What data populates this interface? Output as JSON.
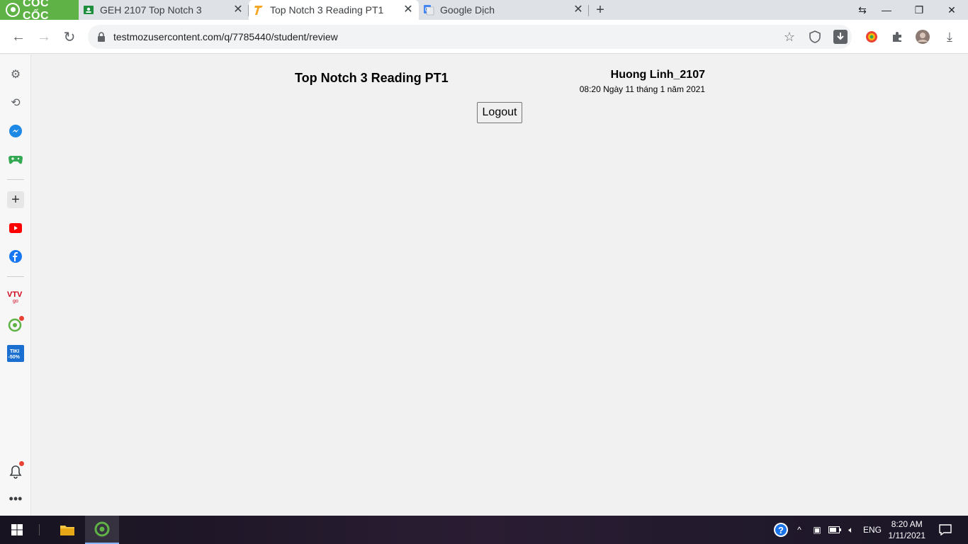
{
  "browser": {
    "brand": "CỐC CỐC",
    "tabs": [
      {
        "title": "GEH 2107 Top Notch 3",
        "icon": "classroom-icon",
        "active": false
      },
      {
        "title": "Top Notch 3 Reading PT1",
        "icon": "quizizz-icon",
        "active": true
      },
      {
        "title": "Google Dịch",
        "icon": "google-translate-icon",
        "active": false
      }
    ],
    "url": "testmozusercontent.com/q/7785440/student/review"
  },
  "sidebar": {
    "badges": {
      "tiki": "TIKI -50%",
      "vtv": "VTV go"
    }
  },
  "page": {
    "title": "Top Notch 3 Reading PT1",
    "user_name": "Huong Linh_2107",
    "timestamp": "08:20 Ngày 11 tháng 1 năm 2021",
    "logout_label": "Logout"
  },
  "taskbar": {
    "language": "ENG",
    "time": "8:20 AM",
    "date": "1/11/2021"
  },
  "colors": {
    "brand_green": "#5fb346",
    "page_bg": "#f1f1f1"
  }
}
